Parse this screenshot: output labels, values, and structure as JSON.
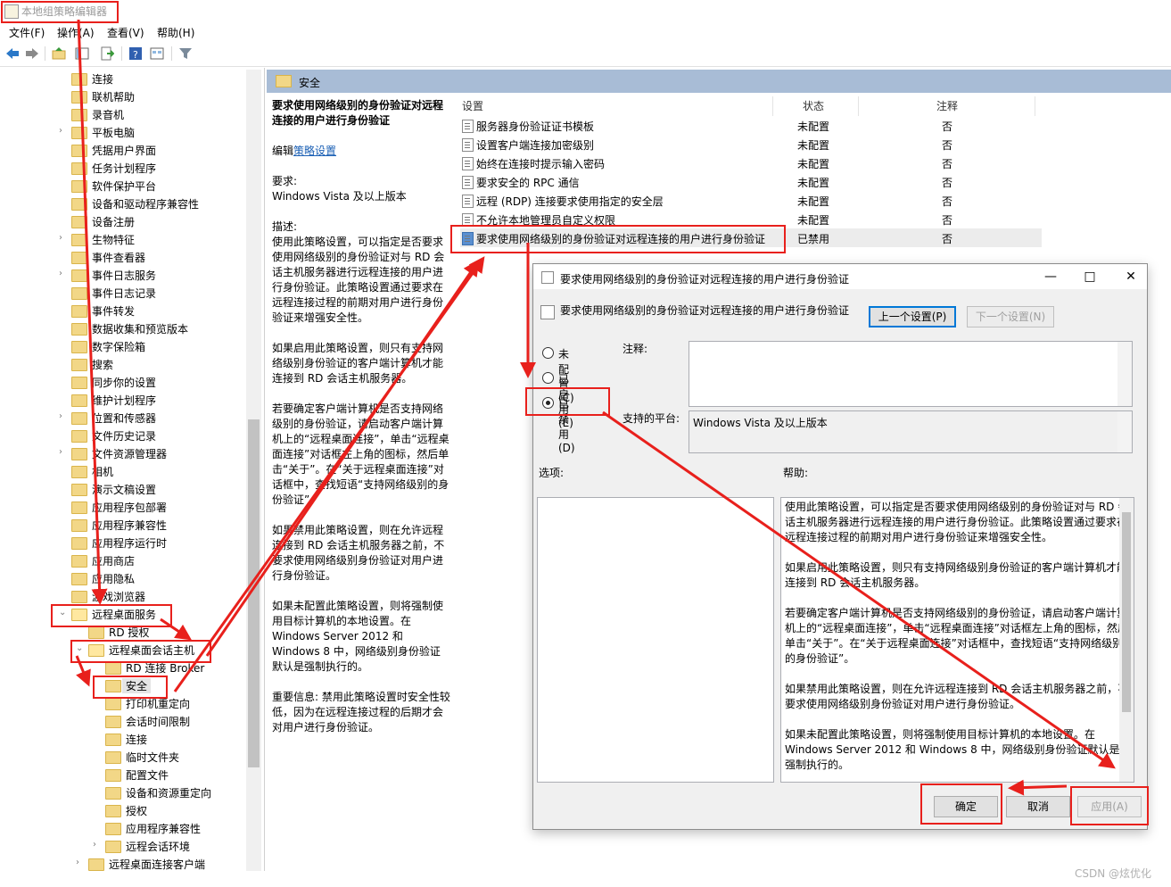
{
  "window": {
    "title": "本地组策略编辑器"
  },
  "menu": [
    "文件(F)",
    "操作(A)",
    "查看(V)",
    "帮助(H)"
  ],
  "toolbar": {
    "icons": [
      "back-icon",
      "forward-icon",
      "up-folder-icon",
      "show-hide-tree-icon",
      "export-list-icon",
      "help-icon",
      "properties-icon",
      "filter-icon"
    ]
  },
  "tree": {
    "items": [
      {
        "label": "连接",
        "arrow": ""
      },
      {
        "label": "联机帮助",
        "arrow": ""
      },
      {
        "label": "录音机",
        "arrow": ""
      },
      {
        "label": "平板电脑",
        "arrow": "›"
      },
      {
        "label": "凭据用户界面",
        "arrow": ""
      },
      {
        "label": "任务计划程序",
        "arrow": ""
      },
      {
        "label": "软件保护平台",
        "arrow": ""
      },
      {
        "label": "设备和驱动程序兼容性",
        "arrow": ""
      },
      {
        "label": "设备注册",
        "arrow": ""
      },
      {
        "label": "生物特征",
        "arrow": "›"
      },
      {
        "label": "事件查看器",
        "arrow": ""
      },
      {
        "label": "事件日志服务",
        "arrow": "›"
      },
      {
        "label": "事件日志记录",
        "arrow": ""
      },
      {
        "label": "事件转发",
        "arrow": ""
      },
      {
        "label": "数据收集和预览版本",
        "arrow": ""
      },
      {
        "label": "数字保险箱",
        "arrow": ""
      },
      {
        "label": "搜索",
        "arrow": ""
      },
      {
        "label": "同步你的设置",
        "arrow": ""
      },
      {
        "label": "维护计划程序",
        "arrow": ""
      },
      {
        "label": "位置和传感器",
        "arrow": "›"
      },
      {
        "label": "文件历史记录",
        "arrow": ""
      },
      {
        "label": "文件资源管理器",
        "arrow": "›"
      },
      {
        "label": "相机",
        "arrow": ""
      },
      {
        "label": "演示文稿设置",
        "arrow": ""
      },
      {
        "label": "应用程序包部署",
        "arrow": ""
      },
      {
        "label": "应用程序兼容性",
        "arrow": ""
      },
      {
        "label": "应用程序运行时",
        "arrow": ""
      },
      {
        "label": "应用商店",
        "arrow": ""
      },
      {
        "label": "应用隐私",
        "arrow": ""
      },
      {
        "label": "游戏浏览器",
        "arrow": ""
      },
      {
        "label": "远程桌面服务",
        "arrow": "⌄"
      },
      {
        "label": "RD 授权",
        "arrow": ""
      },
      {
        "label": "远程桌面会话主机",
        "arrow": "⌄"
      },
      {
        "label": "RD 连接 Broker",
        "arrow": ""
      },
      {
        "label": "安全",
        "arrow": ""
      },
      {
        "label": "打印机重定向",
        "arrow": ""
      },
      {
        "label": "会话时间限制",
        "arrow": ""
      },
      {
        "label": "连接",
        "arrow": ""
      },
      {
        "label": "临时文件夹",
        "arrow": ""
      },
      {
        "label": "配置文件",
        "arrow": ""
      },
      {
        "label": "设备和资源重定向",
        "arrow": ""
      },
      {
        "label": "授权",
        "arrow": ""
      },
      {
        "label": "应用程序兼容性",
        "arrow": ""
      },
      {
        "label": "远程会话环境",
        "arrow": "›"
      },
      {
        "label": "远程桌面连接客户端",
        "arrow": "›"
      }
    ]
  },
  "main": {
    "folder_title": "安全",
    "description": {
      "title": "要求使用网络级别的身份验证对远程连接的用户进行身份验证",
      "edit_prefix": "编辑",
      "edit_link": "策略设置",
      "req_label": "要求:",
      "req_value": "Windows Vista 及以上版本",
      "desc_label": "描述:",
      "paragraphs": [
        "使用此策略设置，可以指定是否要求使用网络级别的身份验证对与 RD 会话主机服务器进行远程连接的用户进行身份验证。此策略设置通过要求在远程连接过程的前期对用户进行身份验证来增强安全性。",
        "如果启用此策略设置，则只有支持网络级别身份验证的客户端计算机才能连接到 RD 会话主机服务器。",
        "若要确定客户端计算机是否支持网络级别的身份验证，请启动客户端计算机上的“远程桌面连接”，单击“远程桌面连接”对话框左上角的图标，然后单击“关于”。在“关于远程桌面连接”对话框中，查找短语“支持网络级别的身份验证”。",
        "如果禁用此策略设置，则在允许远程连接到 RD 会话主机服务器之前，不要求使用网络级别身份验证对用户进行身份验证。",
        "如果未配置此策略设置，则将强制使用目标计算机的本地设置。在 Windows Server 2012 和 Windows 8 中，网络级别身份验证默认是强制执行的。",
        "重要信息: 禁用此策略设置时安全性较低，因为在远程连接过程的后期才会对用户进行身份验证。"
      ]
    },
    "columns": {
      "setting": "设置",
      "state": "状态",
      "note": "注释"
    },
    "rows": [
      {
        "name": "服务器身份验证证书模板",
        "state": "未配置",
        "note": "否"
      },
      {
        "name": "设置客户端连接加密级别",
        "state": "未配置",
        "note": "否"
      },
      {
        "name": "始终在连接时提示输入密码",
        "state": "未配置",
        "note": "否"
      },
      {
        "name": "要求安全的 RPC 通信",
        "state": "未配置",
        "note": "否"
      },
      {
        "name": "远程 (RDP) 连接要求使用指定的安全层",
        "state": "未配置",
        "note": "否"
      },
      {
        "name": "不允许本地管理员自定义权限",
        "state": "未配置",
        "note": "否"
      },
      {
        "name": "要求使用网络级别的身份验证对远程连接的用户进行身份验证",
        "state": "已禁用",
        "note": "否"
      }
    ]
  },
  "dialog": {
    "title": "要求使用网络级别的身份验证对远程连接的用户进行身份验证",
    "header": "要求使用网络级别的身份验证对远程连接的用户进行身份验证",
    "prev_button": "上一个设置(P)",
    "next_button": "下一个设置(N)",
    "radio_not_configured": "未配置(C)",
    "radio_enabled": "已启用(E)",
    "radio_disabled": "已禁用(D)",
    "selected_radio": "已禁用(D)",
    "comment_label": "注释:",
    "comment_value": "",
    "platform_label": "支持的平台:",
    "platform_value": "Windows Vista 及以上版本",
    "options_label": "选项:",
    "help_label": "帮助:",
    "help_paragraphs": [
      "使用此策略设置，可以指定是否要求使用网络级别的身份验证对与 RD 会话主机服务器进行远程连接的用户进行身份验证。此策略设置通过要求在远程连接过程的前期对用户进行身份验证来增强安全性。",
      "如果启用此策略设置，则只有支持网络级别身份验证的客户端计算机才能连接到 RD 会话主机服务器。",
      "若要确定客户端计算机是否支持网络级别的身份验证，请启动客户端计算机上的“远程桌面连接”，单击“远程桌面连接”对话框左上角的图标，然后单击“关于”。在“关于远程桌面连接”对话框中，查找短语“支持网络级别的身份验证”。",
      "如果禁用此策略设置，则在允许远程连接到 RD 会话主机服务器之前，不要求使用网络级别身份验证对用户进行身份验证。",
      "如果未配置此策略设置，则将强制使用目标计算机的本地设置。在 Windows Server 2012 和 Windows 8 中，网络级别身份验证默认是强制执行的。"
    ],
    "ok_button": "确定",
    "cancel_button": "取消",
    "apply_button": "应用(A)"
  },
  "watermark": "CSDN @炫优化",
  "colors": {
    "annotation_red": "#e8201c",
    "header_blue": "#a8bcd6",
    "primary_border": "#0078d7"
  }
}
